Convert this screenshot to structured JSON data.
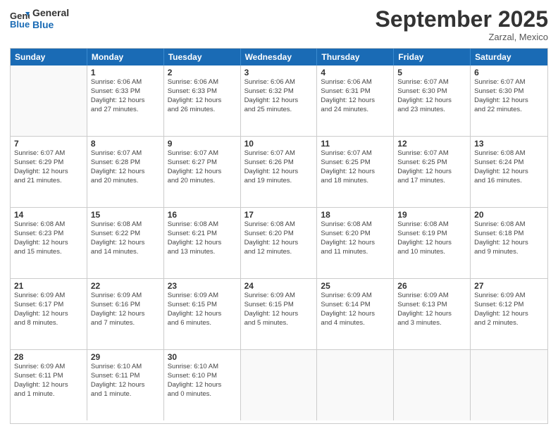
{
  "logo": {
    "line1": "General",
    "line2": "Blue"
  },
  "title": "September 2025",
  "location": "Zarzal, Mexico",
  "days_of_week": [
    "Sunday",
    "Monday",
    "Tuesday",
    "Wednesday",
    "Thursday",
    "Friday",
    "Saturday"
  ],
  "weeks": [
    [
      {
        "day": "",
        "info": ""
      },
      {
        "day": "1",
        "info": "Sunrise: 6:06 AM\nSunset: 6:33 PM\nDaylight: 12 hours\nand 27 minutes."
      },
      {
        "day": "2",
        "info": "Sunrise: 6:06 AM\nSunset: 6:33 PM\nDaylight: 12 hours\nand 26 minutes."
      },
      {
        "day": "3",
        "info": "Sunrise: 6:06 AM\nSunset: 6:32 PM\nDaylight: 12 hours\nand 25 minutes."
      },
      {
        "day": "4",
        "info": "Sunrise: 6:06 AM\nSunset: 6:31 PM\nDaylight: 12 hours\nand 24 minutes."
      },
      {
        "day": "5",
        "info": "Sunrise: 6:07 AM\nSunset: 6:30 PM\nDaylight: 12 hours\nand 23 minutes."
      },
      {
        "day": "6",
        "info": "Sunrise: 6:07 AM\nSunset: 6:30 PM\nDaylight: 12 hours\nand 22 minutes."
      }
    ],
    [
      {
        "day": "7",
        "info": "Sunrise: 6:07 AM\nSunset: 6:29 PM\nDaylight: 12 hours\nand 21 minutes."
      },
      {
        "day": "8",
        "info": "Sunrise: 6:07 AM\nSunset: 6:28 PM\nDaylight: 12 hours\nand 20 minutes."
      },
      {
        "day": "9",
        "info": "Sunrise: 6:07 AM\nSunset: 6:27 PM\nDaylight: 12 hours\nand 20 minutes."
      },
      {
        "day": "10",
        "info": "Sunrise: 6:07 AM\nSunset: 6:26 PM\nDaylight: 12 hours\nand 19 minutes."
      },
      {
        "day": "11",
        "info": "Sunrise: 6:07 AM\nSunset: 6:25 PM\nDaylight: 12 hours\nand 18 minutes."
      },
      {
        "day": "12",
        "info": "Sunrise: 6:07 AM\nSunset: 6:25 PM\nDaylight: 12 hours\nand 17 minutes."
      },
      {
        "day": "13",
        "info": "Sunrise: 6:08 AM\nSunset: 6:24 PM\nDaylight: 12 hours\nand 16 minutes."
      }
    ],
    [
      {
        "day": "14",
        "info": "Sunrise: 6:08 AM\nSunset: 6:23 PM\nDaylight: 12 hours\nand 15 minutes."
      },
      {
        "day": "15",
        "info": "Sunrise: 6:08 AM\nSunset: 6:22 PM\nDaylight: 12 hours\nand 14 minutes."
      },
      {
        "day": "16",
        "info": "Sunrise: 6:08 AM\nSunset: 6:21 PM\nDaylight: 12 hours\nand 13 minutes."
      },
      {
        "day": "17",
        "info": "Sunrise: 6:08 AM\nSunset: 6:20 PM\nDaylight: 12 hours\nand 12 minutes."
      },
      {
        "day": "18",
        "info": "Sunrise: 6:08 AM\nSunset: 6:20 PM\nDaylight: 12 hours\nand 11 minutes."
      },
      {
        "day": "19",
        "info": "Sunrise: 6:08 AM\nSunset: 6:19 PM\nDaylight: 12 hours\nand 10 minutes."
      },
      {
        "day": "20",
        "info": "Sunrise: 6:08 AM\nSunset: 6:18 PM\nDaylight: 12 hours\nand 9 minutes."
      }
    ],
    [
      {
        "day": "21",
        "info": "Sunrise: 6:09 AM\nSunset: 6:17 PM\nDaylight: 12 hours\nand 8 minutes."
      },
      {
        "day": "22",
        "info": "Sunrise: 6:09 AM\nSunset: 6:16 PM\nDaylight: 12 hours\nand 7 minutes."
      },
      {
        "day": "23",
        "info": "Sunrise: 6:09 AM\nSunset: 6:15 PM\nDaylight: 12 hours\nand 6 minutes."
      },
      {
        "day": "24",
        "info": "Sunrise: 6:09 AM\nSunset: 6:15 PM\nDaylight: 12 hours\nand 5 minutes."
      },
      {
        "day": "25",
        "info": "Sunrise: 6:09 AM\nSunset: 6:14 PM\nDaylight: 12 hours\nand 4 minutes."
      },
      {
        "day": "26",
        "info": "Sunrise: 6:09 AM\nSunset: 6:13 PM\nDaylight: 12 hours\nand 3 minutes."
      },
      {
        "day": "27",
        "info": "Sunrise: 6:09 AM\nSunset: 6:12 PM\nDaylight: 12 hours\nand 2 minutes."
      }
    ],
    [
      {
        "day": "28",
        "info": "Sunrise: 6:09 AM\nSunset: 6:11 PM\nDaylight: 12 hours\nand 1 minute."
      },
      {
        "day": "29",
        "info": "Sunrise: 6:10 AM\nSunset: 6:11 PM\nDaylight: 12 hours\nand 1 minute."
      },
      {
        "day": "30",
        "info": "Sunrise: 6:10 AM\nSunset: 6:10 PM\nDaylight: 12 hours\nand 0 minutes."
      },
      {
        "day": "",
        "info": ""
      },
      {
        "day": "",
        "info": ""
      },
      {
        "day": "",
        "info": ""
      },
      {
        "day": "",
        "info": ""
      }
    ]
  ]
}
